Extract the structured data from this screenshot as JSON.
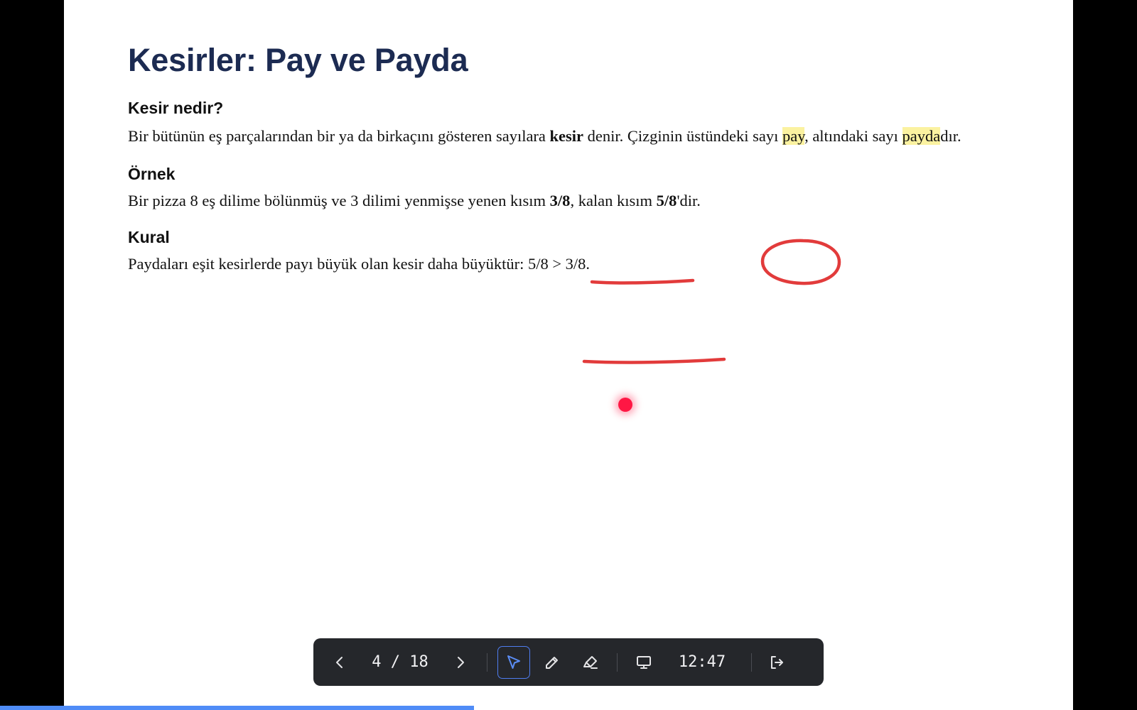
{
  "slide": {
    "title": "Kesirler: Pay ve Payda",
    "sections": [
      {
        "heading": "Kesir nedir?",
        "parts": [
          "Bir bütünün eş parçalarından bir ya da birkaçını gösteren sayılara ",
          "kesir",
          " denir. Çizginin üstündeki sayı ",
          "pay",
          ", altındaki sayı ",
          "payda",
          "dır."
        ]
      },
      {
        "heading": "Örnek",
        "parts": [
          "Bir pizza 8 eş dilime bölünmüş ve 3 dilimi yenmişse yenen kısım ",
          "3/8",
          ", kalan kısım ",
          "5/8",
          "'dir."
        ]
      },
      {
        "heading": "Kural",
        "text": "Paydaları eşit kesirlerde payı büyük olan kesir daha büyüktür: 5/8 > 3/8."
      }
    ]
  },
  "toolbar": {
    "current_page": 4,
    "total_pages": 18,
    "page_separator": " / ",
    "clock": "12:47",
    "icons": {
      "prev": "chevron-left-icon",
      "next": "chevron-right-icon",
      "pointer": "pointer-icon",
      "pen": "pen-icon",
      "highlighter": "highlighter-icon",
      "display": "monitor-icon",
      "exit": "exit-icon"
    },
    "active_tool": "pointer",
    "accent_color": "#4f7df0"
  },
  "annotations": {
    "ink_color": "#e23b3b",
    "laser_color": "#ff1744"
  },
  "progress": {
    "fraction": 0.4167,
    "color": "#4f8cf7"
  }
}
